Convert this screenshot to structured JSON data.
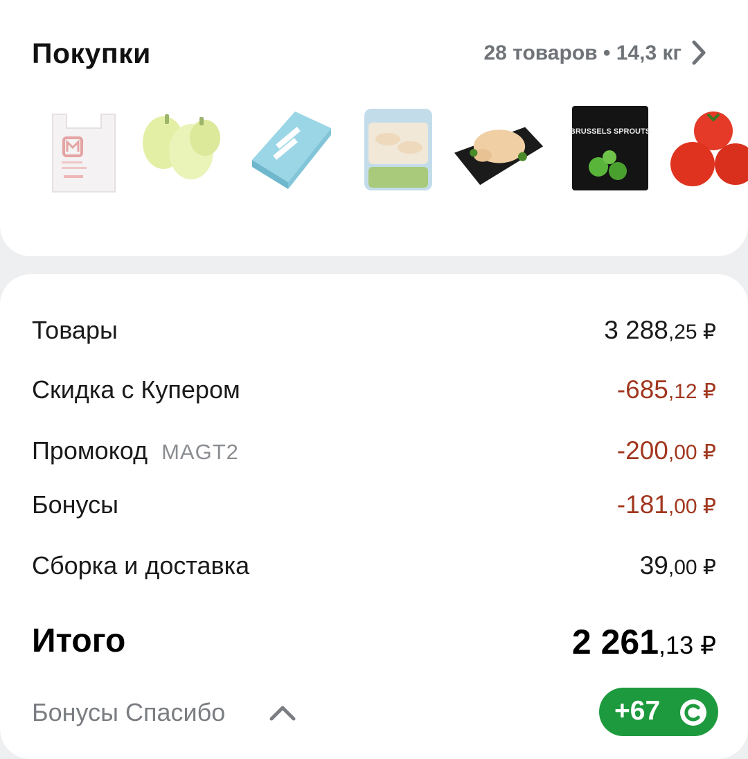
{
  "purchases": {
    "title": "Покупки",
    "meta": "28 товаров • 14,3 кг",
    "products": [
      {
        "icon": "magnit-bag-icon"
      },
      {
        "icon": "yellow-peppers-icon"
      },
      {
        "icon": "plombir-icecream-icon"
      },
      {
        "icon": "chicken-legs-pack-icon"
      },
      {
        "icon": "whole-chicken-icon"
      },
      {
        "icon": "brussels-sprouts-pack-icon",
        "text": "BRUSSELS SPROUTS"
      },
      {
        "icon": "tomatoes-icon"
      }
    ]
  },
  "summary": {
    "goods": {
      "label": "Товары",
      "int": "3 288",
      "dec": ",25 ₽"
    },
    "discount": {
      "label": "Скидка с Купером",
      "int": "-685",
      "dec": ",12 ₽"
    },
    "promo": {
      "label": "Промокод",
      "code": "MAGT2",
      "int": "-200",
      "dec": ",00 ₽"
    },
    "bonuses": {
      "label": "Бонусы",
      "int": "-181",
      "dec": ",00 ₽"
    },
    "delivery": {
      "label": "Сборка и доставка",
      "int": "39",
      "dec": ",00 ₽"
    },
    "total": {
      "label": "Итого",
      "int": "2 261",
      "dec": ",13 ₽"
    },
    "spasibo": {
      "label": "Бонусы Спасибо",
      "badge": "+67",
      "badge_icon": "spasibo-coin-icon"
    }
  },
  "colors": {
    "negative": "#a1371f",
    "badge": "#1d9a3e",
    "muted": "#7a7d81"
  }
}
